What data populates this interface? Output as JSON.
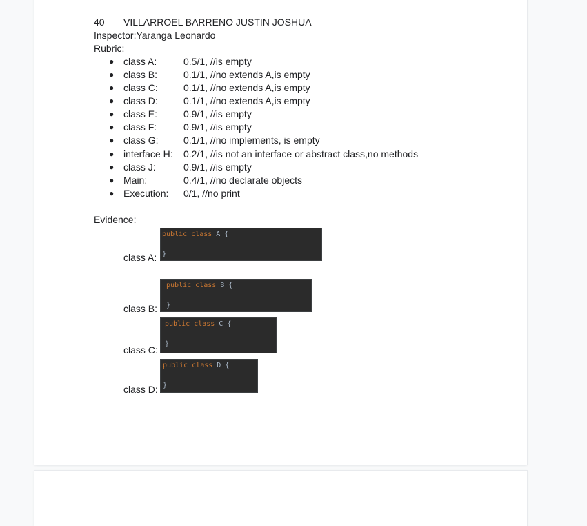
{
  "header": {
    "number": "40",
    "student": "VILLARROEL BARRENO JUSTIN JOSHUA",
    "inspector": "Inspector:Yaranga Leonardo",
    "rubric_title": "Rubric:"
  },
  "rubric": [
    {
      "label": "class A:",
      "value": "0.5/1,  //is empty"
    },
    {
      "label": "class B:",
      "value": "0.1/1, //no extends A,is empty"
    },
    {
      "label": "class C:",
      "value": "0.1/1, //no extends A,is empty"
    },
    {
      "label": "class D:",
      "value": "0.1/1, //no extends A,is empty"
    },
    {
      "label": "class E:",
      "value": "0.9/1, //is empty"
    },
    {
      "label": "class F:",
      "value": "0.9/1, //is empty"
    },
    {
      "label": "class G:",
      "value": "0.1/1, //no implements, is empty"
    },
    {
      "label": "interface H:",
      "value": "0.2/1, //is not an interface or abstract class,no methods"
    },
    {
      "label": "class J:",
      "value": "0.9/1, //is empty"
    },
    {
      "label": "Main:",
      "value": "0.4/1, //no declarate objects"
    },
    {
      "label": "Execution:",
      "value": "0/1, //no print"
    }
  ],
  "evidence": {
    "title": "Evidence:",
    "items": [
      {
        "label": "class A:",
        "kw1": "public",
        "kw2": "class",
        "name": "A",
        "open": "{",
        "close": "}"
      },
      {
        "label": "class B:",
        "kw1": "public",
        "kw2": "class",
        "name": "B",
        "open": "{",
        "close": "}"
      },
      {
        "label": "class C:",
        "kw1": "public",
        "kw2": "class",
        "name": "C",
        "open": "{",
        "close": "}"
      },
      {
        "label": "class D:",
        "kw1": "public",
        "kw2": "class",
        "name": "D",
        "open": "{",
        "close": "}"
      }
    ]
  },
  "colors": {
    "keyword": "#cc7832",
    "code_bg": "#2b2b2b",
    "code_text": "#a9b7c6",
    "page_bg": "#f8f9fa"
  }
}
